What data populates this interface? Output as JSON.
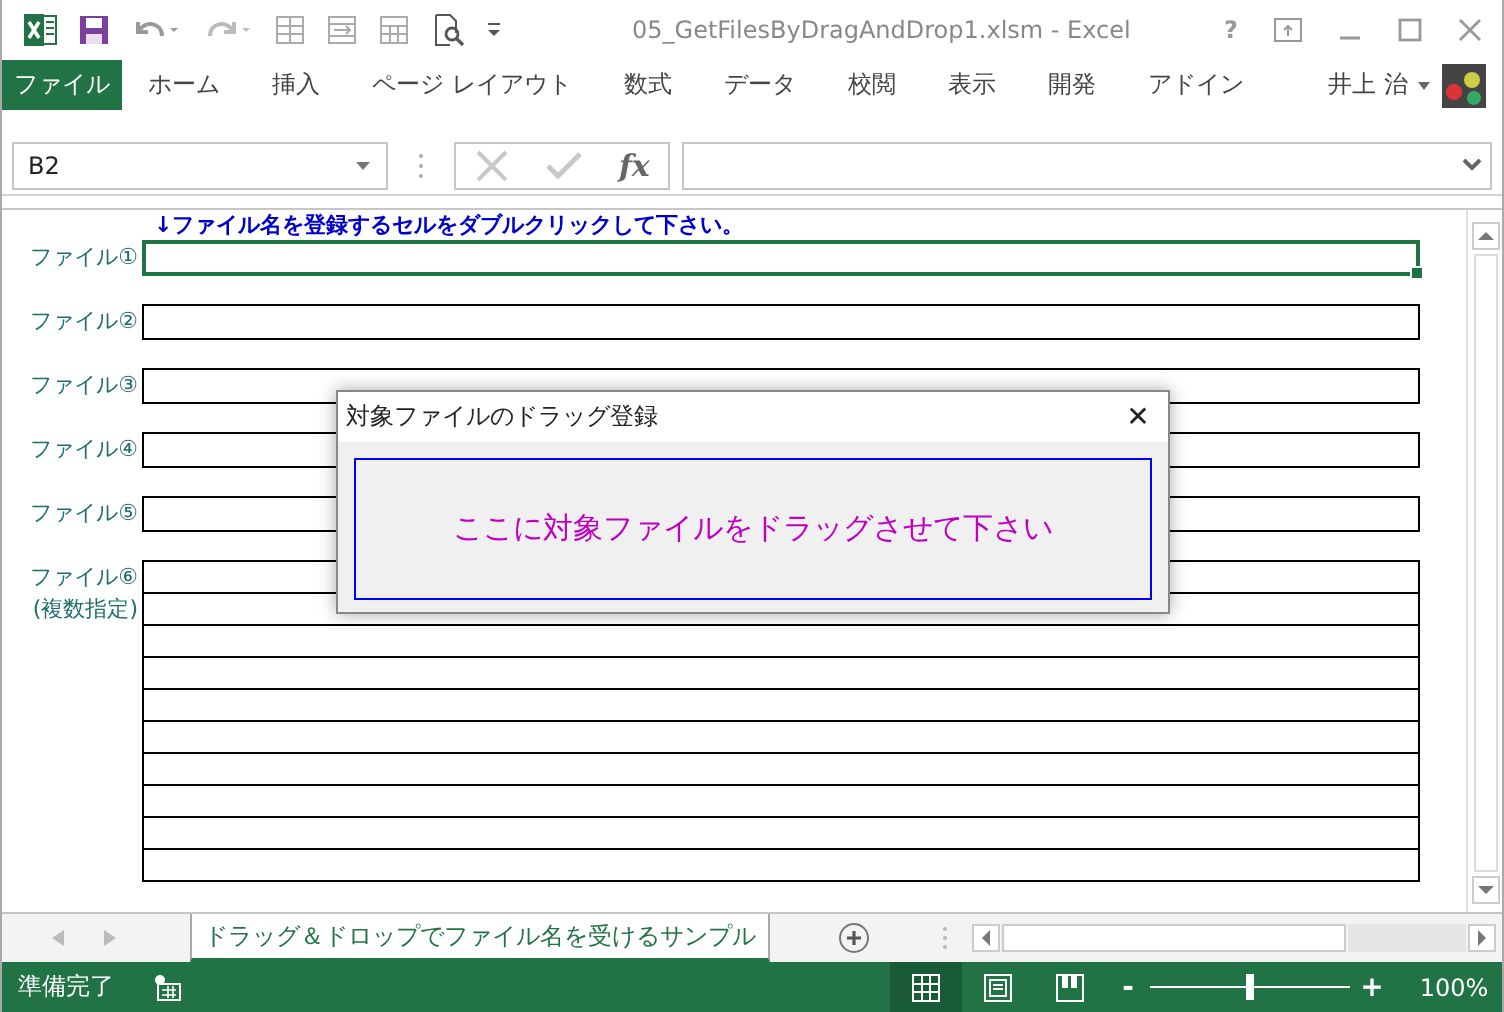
{
  "window": {
    "title": "05_GetFilesByDragAndDrop1.xlsm - Excel",
    "help": "?"
  },
  "ribbon_tabs": [
    {
      "label": "ファイル",
      "kind": "file"
    },
    {
      "label": "ホーム",
      "kind": "tab"
    },
    {
      "label": "挿入",
      "kind": "tab"
    },
    {
      "label": "ページ レイアウト",
      "kind": "tab"
    },
    {
      "label": "数式",
      "kind": "tab"
    },
    {
      "label": "データ",
      "kind": "tab"
    },
    {
      "label": "校閲",
      "kind": "tab"
    },
    {
      "label": "表示",
      "kind": "tab"
    },
    {
      "label": "開発",
      "kind": "tab"
    },
    {
      "label": "アドイン",
      "kind": "tab"
    }
  ],
  "user": {
    "name": "井上 治"
  },
  "formula_bar": {
    "name_box": "B2",
    "fx": "fx"
  },
  "sheet": {
    "instruction": "↓ファイル名を登録するセルをダブルクリックして下さい。",
    "rows": [
      {
        "kind": "single",
        "label": "ファイル①",
        "selected": true
      },
      {
        "kind": "single",
        "label": "ファイル②",
        "selected": false
      },
      {
        "kind": "single",
        "label": "ファイル③",
        "selected": false
      },
      {
        "kind": "single",
        "label": "ファイル④",
        "selected": false
      },
      {
        "kind": "single",
        "label": "ファイル⑤",
        "selected": false
      },
      {
        "kind": "multi",
        "label": "ファイル⑥",
        "note": "(複数指定)",
        "selected": false
      }
    ]
  },
  "dialog": {
    "title": "対象ファイルのドラッグ登録",
    "close": "✕",
    "drop_text": "ここに対象ファイルをドラッグさせて下さい"
  },
  "sheet_tabs": [
    {
      "label": "ドラッグ＆ドロップでファイル名を受けるサンプル",
      "selected": true
    }
  ],
  "status_bar": {
    "status": "準備完了",
    "views": [
      {
        "kind": "normal",
        "selected": true
      },
      {
        "kind": "layout",
        "selected": false
      },
      {
        "kind": "pagebreak",
        "selected": false
      }
    ],
    "zoom": {
      "minus": "-",
      "plus": "+",
      "level": 0.5,
      "reading": "100%"
    }
  }
}
